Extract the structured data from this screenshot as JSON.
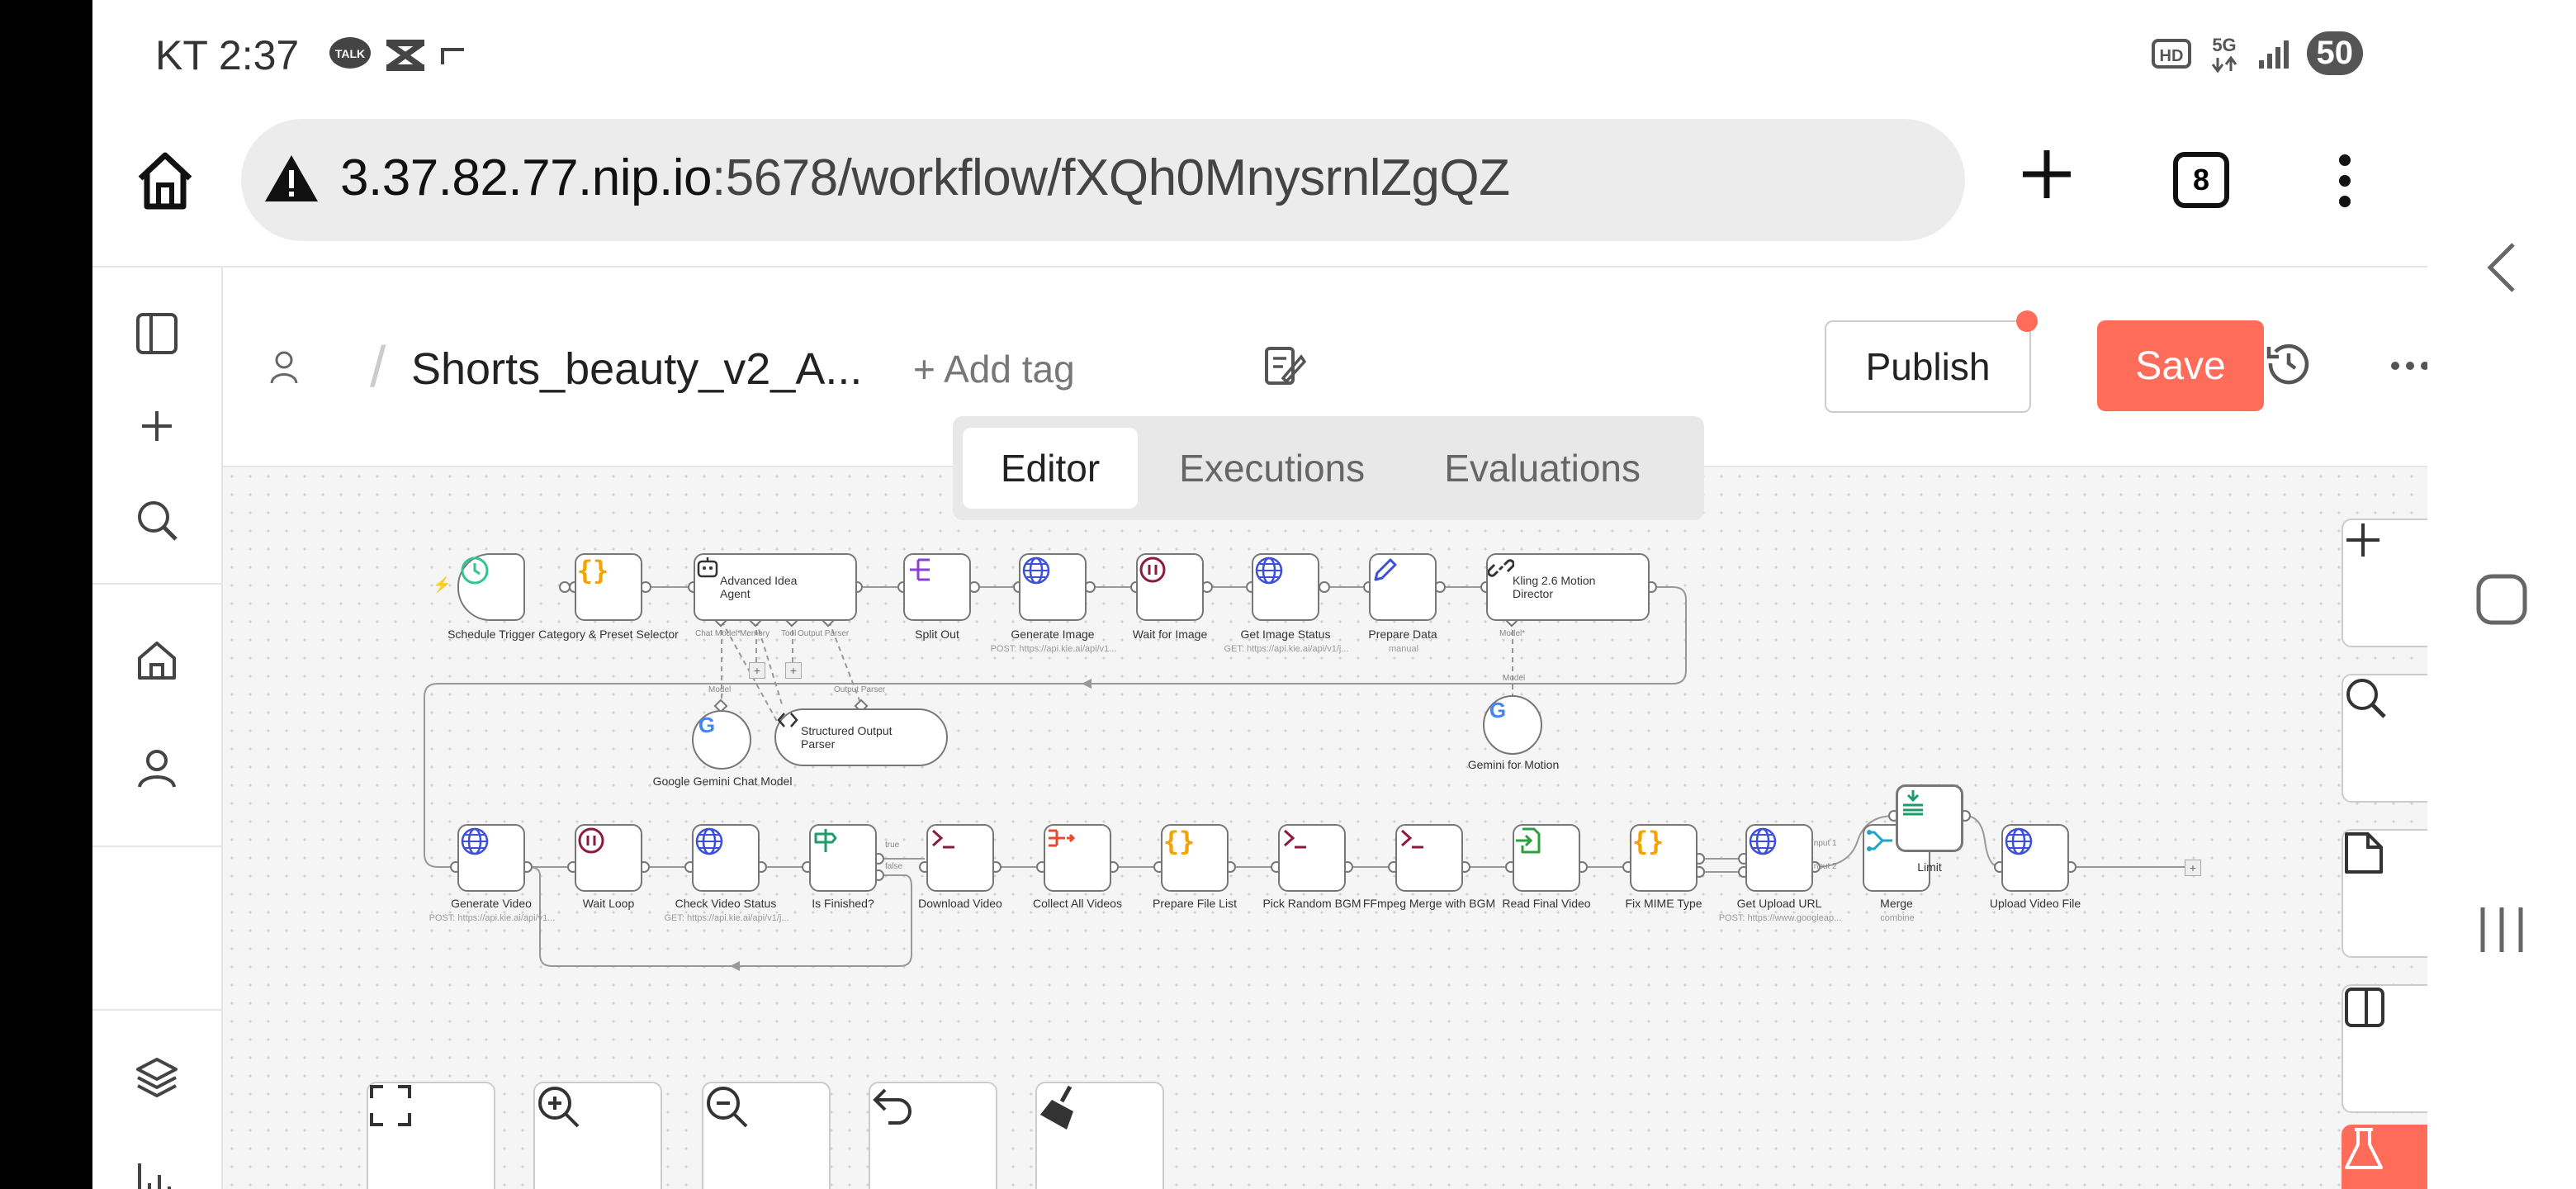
{
  "status_bar": {
    "time": "KT 2:37",
    "battery": "50"
  },
  "browser": {
    "url_host": "3.37.82.77.nip.io",
    "url_path": ":5678/workflow/fXQh0MnysrnlZgQZ",
    "tab_count": "8"
  },
  "header": {
    "workflow_name": "Shorts_beauty_v2_A...",
    "add_tag": "+ Add tag",
    "publish": "Publish",
    "save": "Save"
  },
  "tabs": [
    "Editor",
    "Executions",
    "Evaluations"
  ],
  "nodes": {
    "schedule_trigger": "Schedule Trigger",
    "category_selector": "Category & Preset Selector",
    "idea_agent": "Advanced Idea Agent",
    "split_out": "Split Out",
    "generate_image": "Generate Image",
    "generate_image_sub": "POST: https://api.kie.ai/api/v1...",
    "wait_for_image": "Wait for Image",
    "get_image_status": "Get Image Status",
    "get_image_status_sub": "GET: https://api.kie.ai/api/v1/j...",
    "prepare_data": "Prepare Data",
    "prepare_data_sub": "manual",
    "kling": "Kling 2.6 Motion Director",
    "gemini_chat": "Google Gemini Chat Model",
    "structured_parser": "Structured Output Parser",
    "gemini_motion": "Gemini for Motion",
    "generate_video": "Generate Video",
    "generate_video_sub": "POST: https://api.kie.ai/api/v1...",
    "wait_loop": "Wait Loop",
    "check_video_status": "Check Video Status",
    "check_video_status_sub": "GET: https://api.kie.ai/api/v1/j...",
    "is_finished": "Is Finished?",
    "download_video": "Download Video",
    "collect_all_videos": "Collect All Videos",
    "prepare_file_list": "Prepare File List",
    "pick_random_bgm": "Pick Random BGM",
    "ffmpeg_merge": "FFmpeg Merge with BGM",
    "read_final_video": "Read Final Video",
    "fix_mime_type": "Fix MIME Type",
    "get_upload_url": "Get Upload URL",
    "get_upload_url_sub": "POST: https://www.googleap...",
    "merge": "Merge",
    "merge_sub": "combine",
    "limit": "Limit",
    "upload_video_file": "Upload Video File"
  },
  "ports": {
    "chat_model": "Chat Model*",
    "memory": "Memory",
    "tool": "Tool",
    "output_parser": "Output Parser",
    "model": "Model",
    "model_req": "Model*",
    "output_parser2": "Output Parser",
    "model2": "Model",
    "true": "true",
    "false": "false",
    "input1": "Input 1",
    "input2": "Input 2"
  },
  "colors": {
    "accent": "#ff6d5a",
    "http_blue": "#3b4fd8",
    "code_orange": "#f4a300",
    "wait_maroon": "#8b1a3b"
  }
}
